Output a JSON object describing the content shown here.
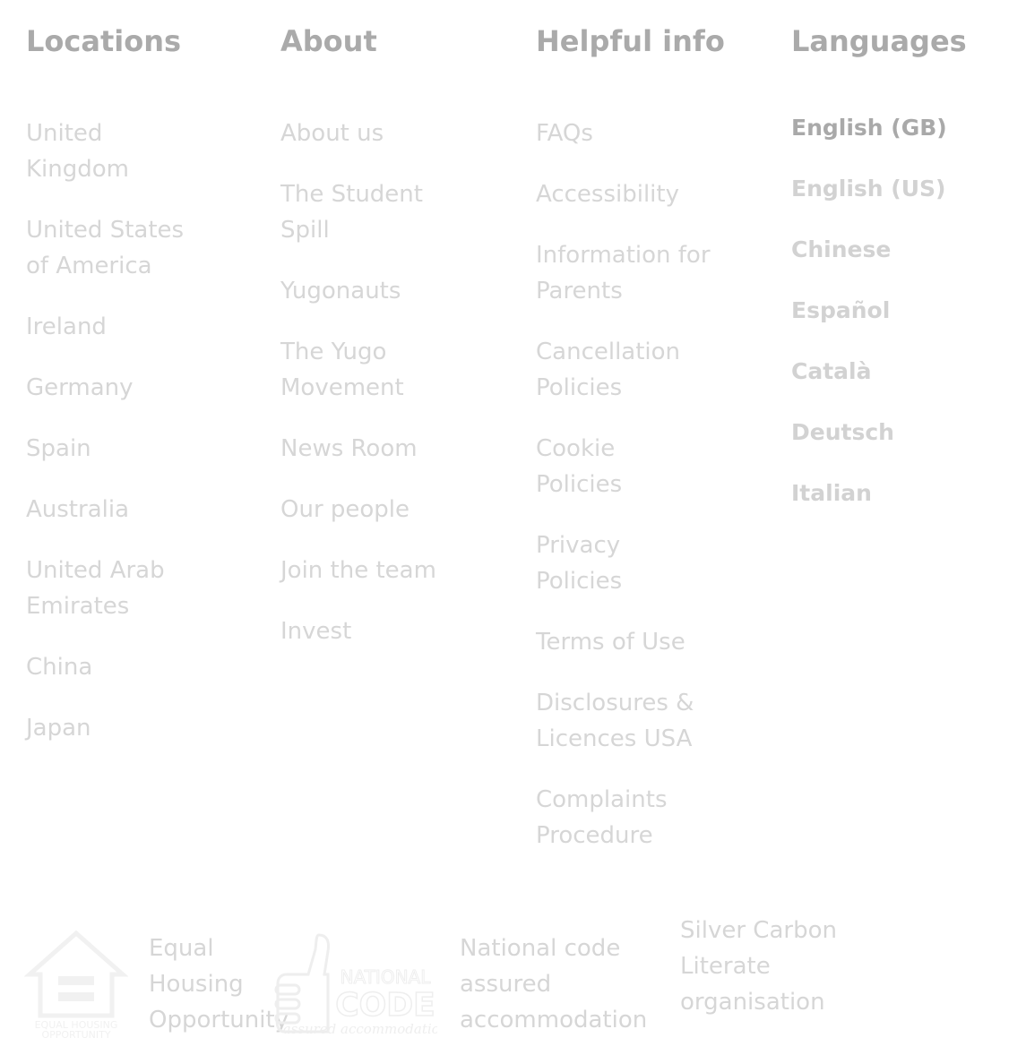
{
  "locations": {
    "title": "Locations",
    "items": [
      {
        "label": "United Kingdom"
      },
      {
        "label": "United States of America"
      },
      {
        "label": "Ireland"
      },
      {
        "label": "Germany"
      },
      {
        "label": "Spain"
      },
      {
        "label": "Australia"
      },
      {
        "label": "United Arab Emirates"
      },
      {
        "label": "China"
      },
      {
        "label": "Japan"
      }
    ]
  },
  "about": {
    "title": "About",
    "items": [
      {
        "label": "About us"
      },
      {
        "label": "The Student Spill"
      },
      {
        "label": "Yugonauts"
      },
      {
        "label": "The Yugo Movement"
      },
      {
        "label": "News Room"
      },
      {
        "label": "Our people"
      },
      {
        "label": "Join the team"
      },
      {
        "label": "Invest"
      }
    ]
  },
  "helpful": {
    "title": "Helpful info",
    "items": [
      {
        "label": "FAQs"
      },
      {
        "label": "Accessibility"
      },
      {
        "label": "Information for Parents"
      },
      {
        "label": "Cancellation Policies"
      },
      {
        "label": "Cookie Policies"
      },
      {
        "label": "Privacy Policies"
      },
      {
        "label": "Terms of Use"
      },
      {
        "label": "Disclosures & Licences USA"
      },
      {
        "label": "Complaints Procedure"
      }
    ]
  },
  "languages": {
    "title": "Languages",
    "selected": "English (GB)",
    "items": [
      {
        "label": "English (GB)"
      },
      {
        "label": "English (US)"
      },
      {
        "label": "Chinese"
      },
      {
        "label": "Español"
      },
      {
        "label": "Català"
      },
      {
        "label": "Deutsch"
      },
      {
        "label": "Italian"
      }
    ]
  },
  "badges": {
    "equal_housing": {
      "label": "Equal Housing Opportunity",
      "logo_text_1": "EQUAL HOUSING",
      "logo_text_2": "OPPORTUNITY"
    },
    "national_code": {
      "label": "National code assured accommodation",
      "logo_text_1": "NATIONAL",
      "logo_text_2": "CODE",
      "logo_text_3": "assured accommodation"
    },
    "carbon_literate": {
      "label": "Silver Carbon Literate organisation"
    }
  },
  "colors": {
    "heading": "#aaaaaa",
    "link": "#d6d6d6",
    "active_language": "#a9a9a9"
  }
}
